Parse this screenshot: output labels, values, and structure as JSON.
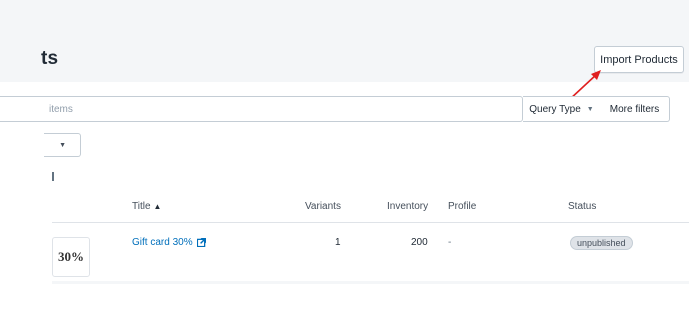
{
  "header": {
    "page_title": "ts",
    "import_button": "Import Products"
  },
  "filters": {
    "search_placeholder": "items",
    "query_type_label": "Query Type",
    "more_filters_label": "More filters"
  },
  "table": {
    "columns": {
      "title": "Title",
      "variants": "Variants",
      "inventory": "Inventory",
      "profile": "Profile",
      "status": "Status"
    },
    "rows": [
      {
        "thumbnail_text": "30%",
        "title": "Gift card 30%",
        "variants": "1",
        "inventory": "200",
        "profile": "-",
        "status": "unpublished"
      }
    ]
  },
  "colors": {
    "header_band": "#f4f6f8",
    "link": "#006fbb",
    "annotation_arrow": "#e02020",
    "badge_bg": "#dfe3e8"
  },
  "icons": {
    "sort": "caret-up-icon",
    "dropdown": "chevron-down-icon",
    "external_link": "external-link-icon"
  }
}
